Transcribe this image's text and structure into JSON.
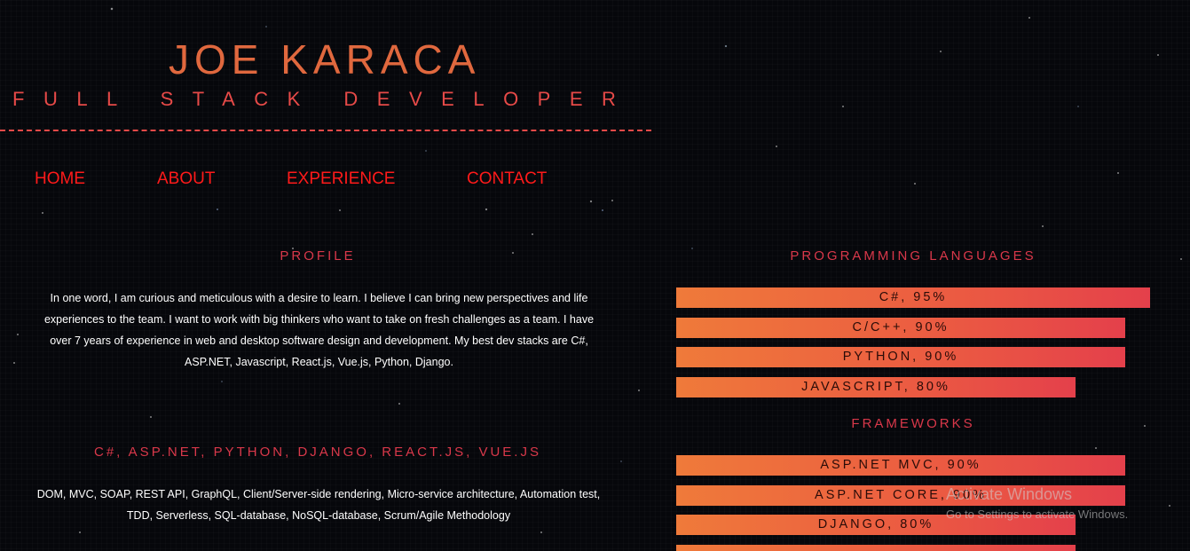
{
  "header": {
    "name": "JOE KARACA",
    "subtitle": "FULL STACK DEVELOPER"
  },
  "nav": {
    "items": [
      {
        "label": "HOME"
      },
      {
        "label": "ABOUT"
      },
      {
        "label": "EXPERIENCE"
      },
      {
        "label": "CONTACT"
      }
    ]
  },
  "profile": {
    "heading": "PROFILE",
    "text": "In one word, I am curious and meticulous with a desire to learn. I believe I can bring new perspectives and life experiences to the team. I want to work with big thinkers who want to take on fresh challenges as a team. I have over 7 years of experience in web and desktop software design and development. My best dev stacks are C#, ASP.NET, Javascript, React.js, Vue.js, Python, Django."
  },
  "stacks": {
    "heading": "C#, ASP.NET, PYTHON, DJANGO, REACT.JS, VUE.JS",
    "text": "DOM, MVC, SOAP, REST API, GraphQL, Client/Server-side rendering, Micro-service architecture, Automation test, TDD, Serverless, SQL-database, NoSQL-database, Scrum/Agile Methodology"
  },
  "skills": {
    "languages_heading": "PROGRAMMING LANGUAGES",
    "languages": [
      {
        "label": "C#, 95%",
        "percent": 95
      },
      {
        "label": "C/C++, 90%",
        "percent": 90
      },
      {
        "label": "PYTHON, 90%",
        "percent": 90
      },
      {
        "label": "JAVASCRIPT, 80%",
        "percent": 80
      }
    ],
    "frameworks_heading": "FRAMEWORKS",
    "frameworks": [
      {
        "label": "ASP.NET MVC, 90%",
        "percent": 90
      },
      {
        "label": "ASP.NET CORE, 90%",
        "percent": 90
      },
      {
        "label": "DJANGO, 80%",
        "percent": 80
      },
      {
        "label": "",
        "percent": 80
      }
    ]
  },
  "watermark": {
    "title": "Activate Windows",
    "subtitle": "Go to Settings to activate Windows."
  },
  "colors": {
    "name": "#e0683e",
    "subtitle": "#e74a48",
    "nav_link": "#ff1a1a",
    "heading": "#d9384a",
    "bar_start": "#ef7a3a",
    "bar_end": "#e4404b",
    "background": "#06070b"
  }
}
